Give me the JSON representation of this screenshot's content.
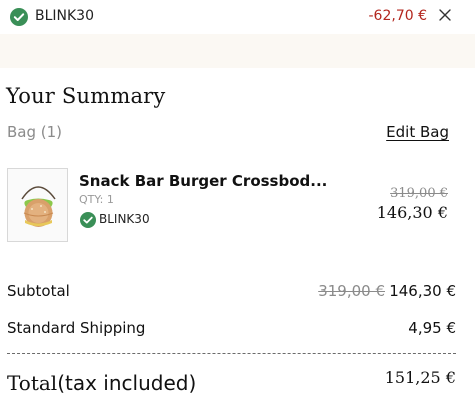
{
  "promo": {
    "code": "BLINK30",
    "amount": "-62,70 €",
    "icons": {
      "applied": "check-circle-icon",
      "remove": "close-icon"
    },
    "colors": {
      "check": "#3a8f57",
      "discount": "#b3261e"
    }
  },
  "summary": {
    "title": "Your Summary",
    "bag_label": "Bag (1)",
    "edit_bag_label": "Edit Bag"
  },
  "product": {
    "name": "Snack Bar Burger Crossbod...",
    "qty": "QTY: 1",
    "promo_code": "BLINK30",
    "price_old": "319,00 €",
    "price_new": "146,30 €"
  },
  "totals": {
    "subtotal_label": "Subtotal",
    "subtotal_old": "319,00 €",
    "subtotal_value": "146,30 €",
    "shipping_label": "Standard Shipping",
    "shipping_value": "4,95 €",
    "total_word": "Total",
    "total_suffix": "(tax included)",
    "total_value": "151,25 €"
  }
}
